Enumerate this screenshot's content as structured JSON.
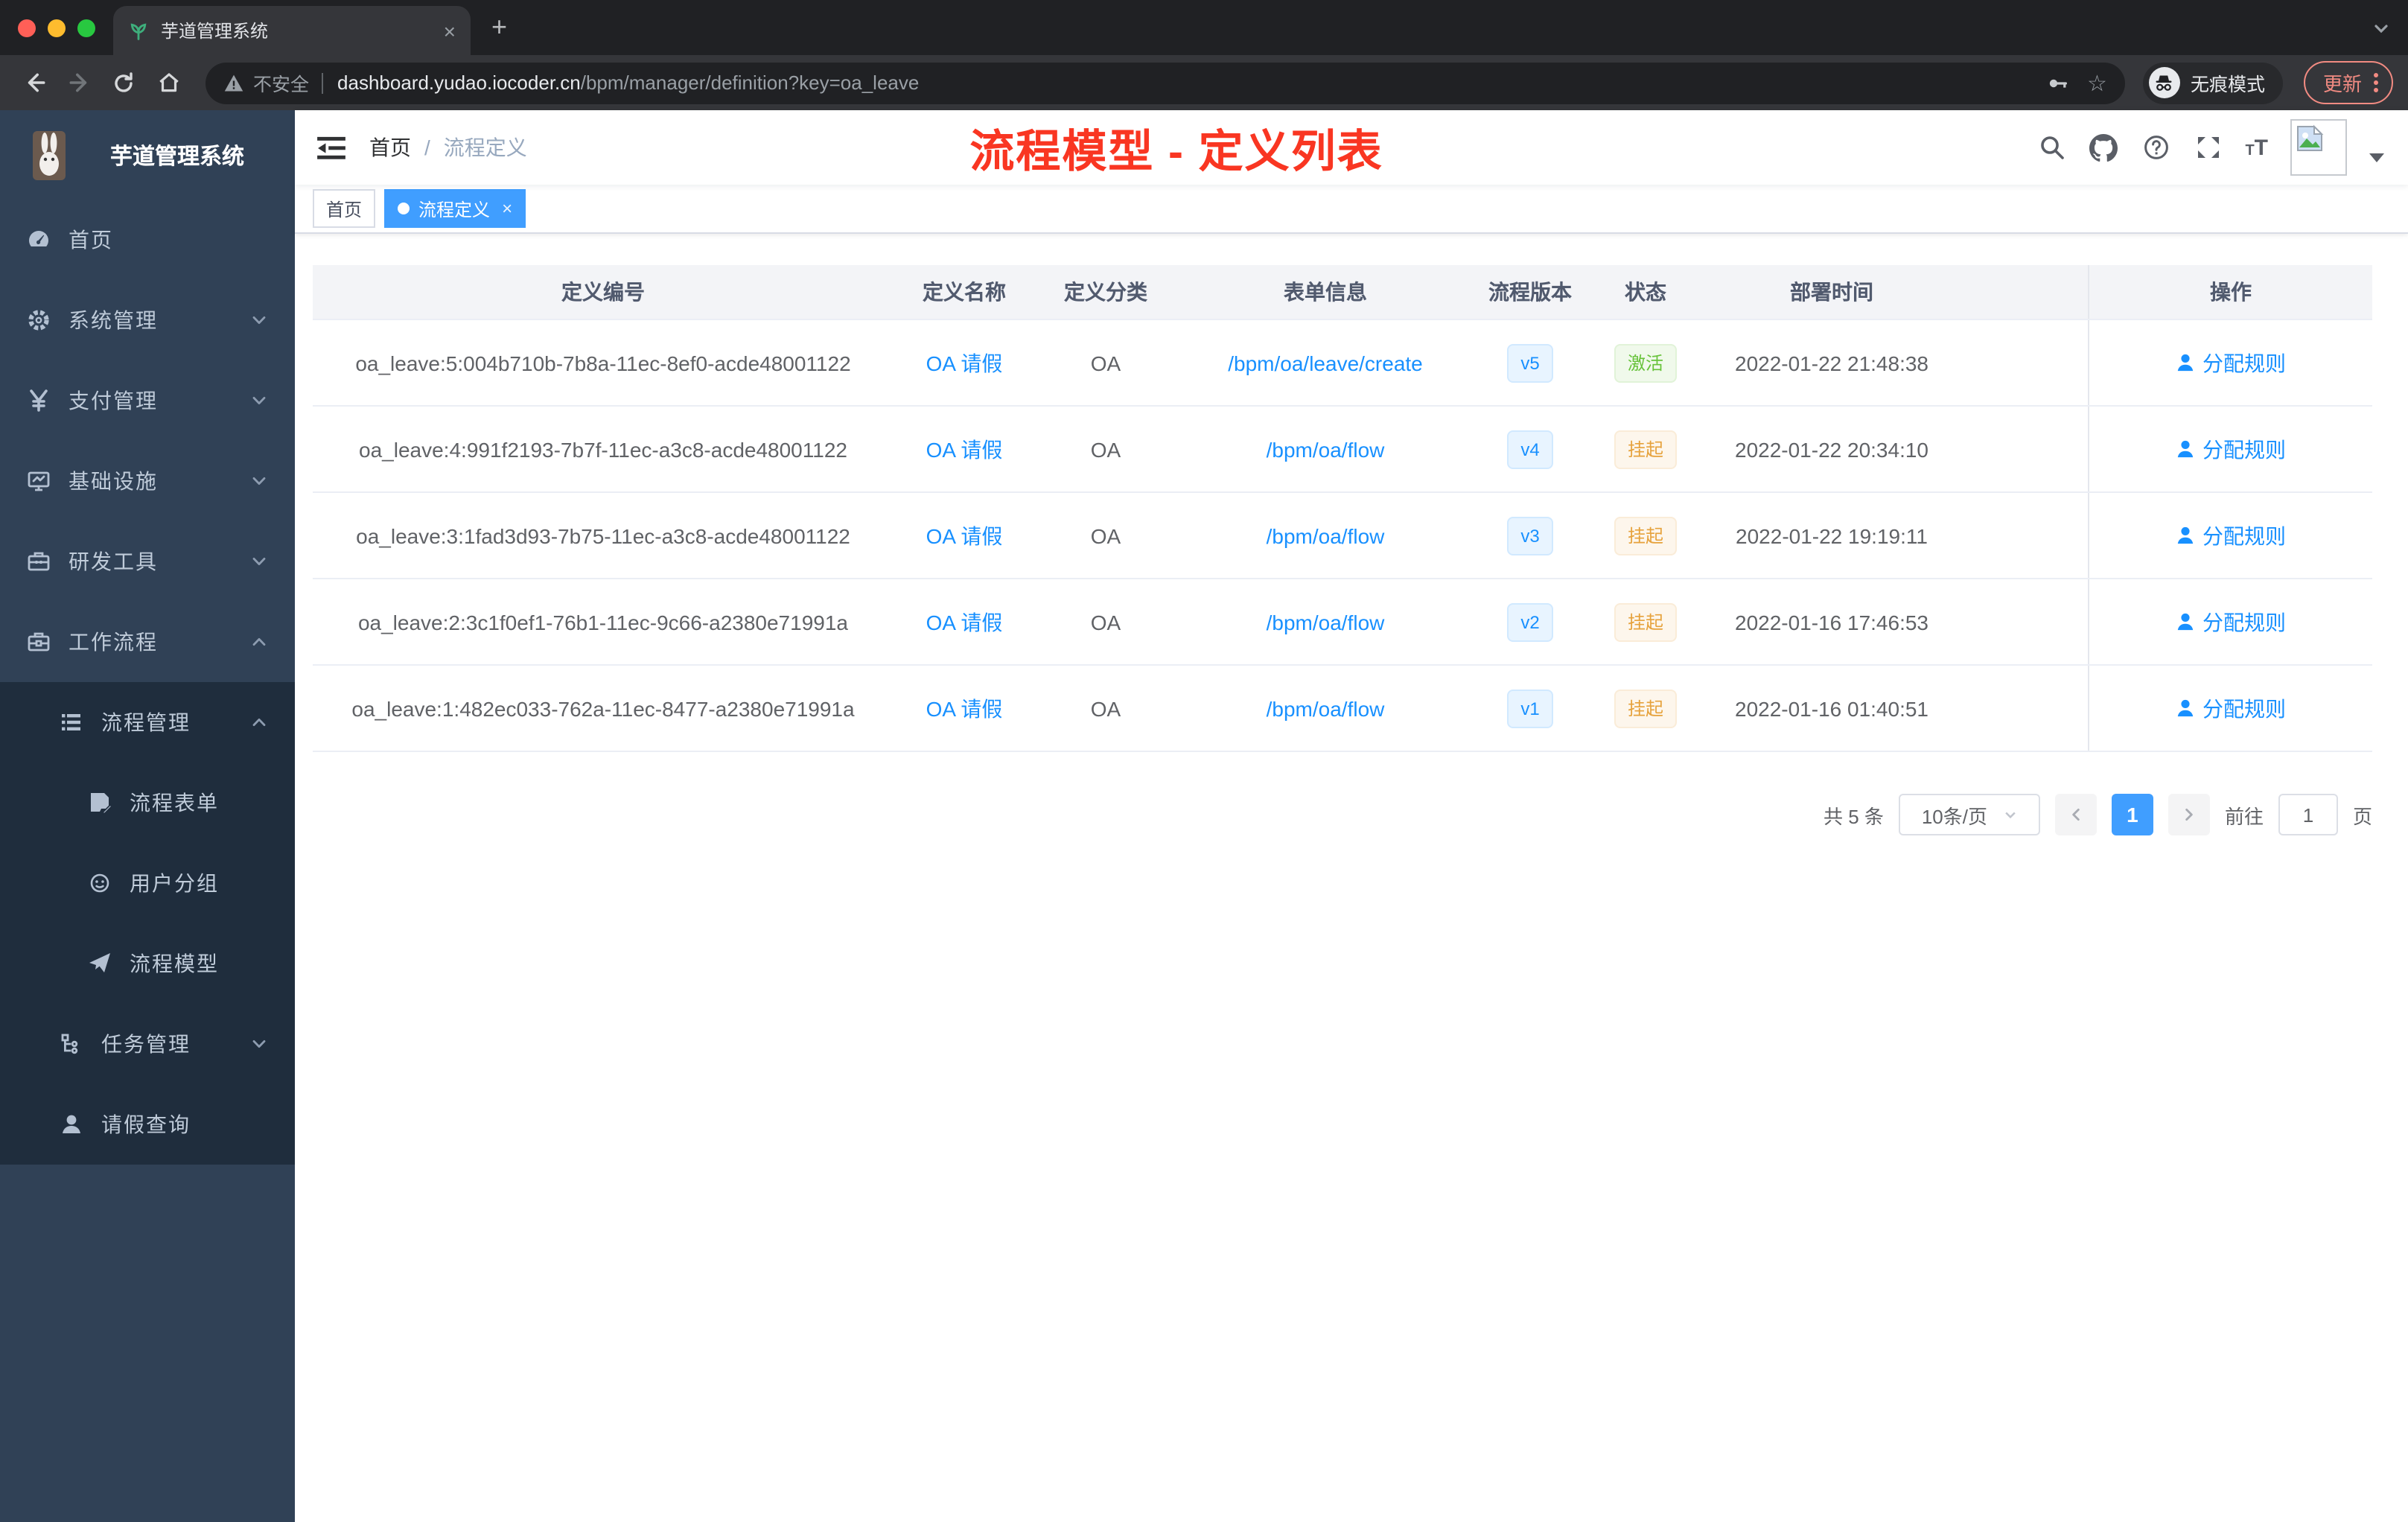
{
  "browser": {
    "tab_title": "芋道管理系统",
    "new_tab_glyph": "+",
    "tab_close_glyph": "×",
    "security_label": "不安全",
    "url_host": "dashboard.yudao.iocoder.cn",
    "url_path": "/bpm/manager/definition?key=oa_leave",
    "incognito_label": "无痕模式",
    "update_label": "更新"
  },
  "sidebar": {
    "logo_title": "芋道管理系统",
    "items": [
      {
        "key": "home",
        "label": "首页",
        "icon": "dashboard-icon",
        "level": 1,
        "chevron": ""
      },
      {
        "key": "system-management",
        "label": "系统管理",
        "icon": "gear-icon",
        "level": 1,
        "chevron": "down"
      },
      {
        "key": "payment-management",
        "label": "支付管理",
        "icon": "yen-icon",
        "level": 1,
        "chevron": "down"
      },
      {
        "key": "infrastructure",
        "label": "基础设施",
        "icon": "monitor-icon",
        "level": 1,
        "chevron": "down"
      },
      {
        "key": "dev-tools",
        "label": "研发工具",
        "icon": "toolbox-icon",
        "level": 1,
        "chevron": "down"
      },
      {
        "key": "workflow",
        "label": "工作流程",
        "icon": "briefcase-icon",
        "level": 1,
        "chevron": "up"
      },
      {
        "key": "process-management",
        "label": "流程管理",
        "icon": "list-icon",
        "level": 2,
        "chevron": "up"
      },
      {
        "key": "process-form",
        "label": "流程表单",
        "icon": "form-icon",
        "level": 3,
        "chevron": ""
      },
      {
        "key": "user-group",
        "label": "用户分组",
        "icon": "user-group-icon",
        "level": 3,
        "chevron": ""
      },
      {
        "key": "process-model",
        "label": "流程模型",
        "icon": "paper-plane-icon",
        "level": 3,
        "chevron": ""
      },
      {
        "key": "task-management",
        "label": "任务管理",
        "icon": "tree-icon",
        "level": 2,
        "chevron": "down"
      },
      {
        "key": "leave-query",
        "label": "请假查询",
        "icon": "user-icon",
        "level": 2,
        "chevron": ""
      }
    ]
  },
  "header": {
    "breadcrumb": [
      "首页",
      "流程定义"
    ],
    "separator": "/",
    "annotation": "流程模型 - 定义列表"
  },
  "tags": [
    {
      "label": "首页",
      "active": false
    },
    {
      "label": "流程定义",
      "active": true,
      "close_glyph": "×"
    }
  ],
  "table": {
    "headers": [
      "定义编号",
      "定义名称",
      "定义分类",
      "表单信息",
      "流程版本",
      "状态",
      "部署时间",
      "操作"
    ],
    "rows": [
      {
        "id": "oa_leave:5:004b710b-7b8a-11ec-8ef0-acde48001122",
        "name": "OA 请假",
        "category": "OA",
        "form": "/bpm/oa/leave/create",
        "version": "v5",
        "status": "激活",
        "status_type": "success",
        "deploy_time": "2022-01-22 21:48:38",
        "action": "分配规则"
      },
      {
        "id": "oa_leave:4:991f2193-7b7f-11ec-a3c8-acde48001122",
        "name": "OA 请假",
        "category": "OA",
        "form": "/bpm/oa/flow",
        "version": "v4",
        "status": "挂起",
        "status_type": "warning",
        "deploy_time": "2022-01-22 20:34:10",
        "action": "分配规则"
      },
      {
        "id": "oa_leave:3:1fad3d93-7b75-11ec-a3c8-acde48001122",
        "name": "OA 请假",
        "category": "OA",
        "form": "/bpm/oa/flow",
        "version": "v3",
        "status": "挂起",
        "status_type": "warning",
        "deploy_time": "2022-01-22 19:19:11",
        "action": "分配规则"
      },
      {
        "id": "oa_leave:2:3c1f0ef1-76b1-11ec-9c66-a2380e71991a",
        "name": "OA 请假",
        "category": "OA",
        "form": "/bpm/oa/flow",
        "version": "v2",
        "status": "挂起",
        "status_type": "warning",
        "deploy_time": "2022-01-16 17:46:53",
        "action": "分配规则"
      },
      {
        "id": "oa_leave:1:482ec033-762a-11ec-8477-a2380e71991a",
        "name": "OA 请假",
        "category": "OA",
        "form": "/bpm/oa/flow",
        "version": "v1",
        "status": "挂起",
        "status_type": "warning",
        "deploy_time": "2022-01-16 01:40:51",
        "action": "分配规则"
      }
    ]
  },
  "pagination": {
    "total": "共 5 条",
    "page_size": "10条/页",
    "current_page": "1",
    "goto_label": "前往",
    "goto_value": "1",
    "unit_label": "页"
  },
  "colors": {
    "accent": "#409eff",
    "link": "#1890ff",
    "success": "#67c23a",
    "warning": "#e6a23c",
    "annotation_red": "#f93622",
    "sidebar_bg": "#304156",
    "submenu_bg": "#1f2d3d"
  }
}
